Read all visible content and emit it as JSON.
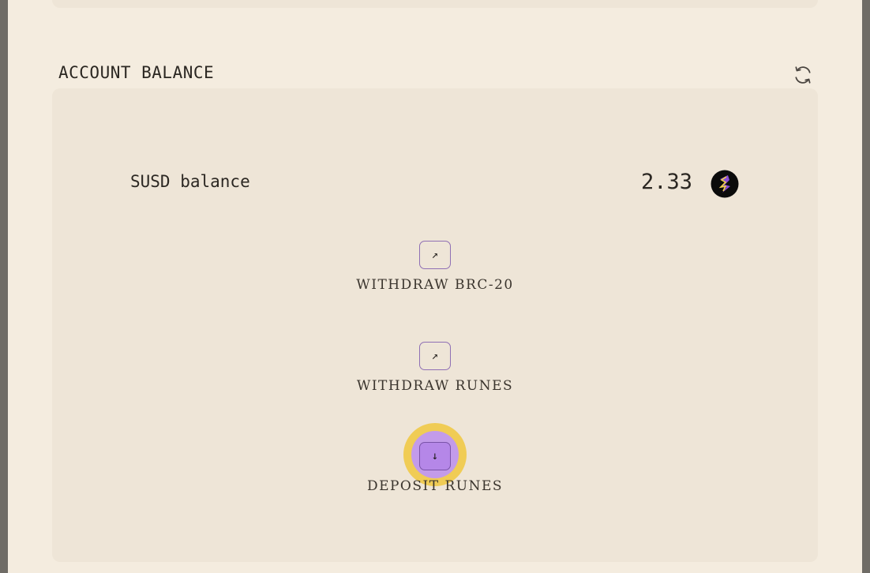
{
  "section": {
    "title": "ACCOUNT BALANCE",
    "refresh_icon": "refresh-icon"
  },
  "balance": {
    "label": "SUSD balance",
    "value": "2.33",
    "token_icon": "susd-token-icon"
  },
  "actions": [
    {
      "label": "WITHDRAW BRC-20",
      "icon": "arrow-up-right-icon",
      "glyph": "↗"
    },
    {
      "label": "WITHDRAW RUNES",
      "icon": "arrow-up-right-icon",
      "glyph": "↗"
    },
    {
      "label": "DEPOSIT RUNES",
      "icon": "arrow-down-icon",
      "glyph": "↓"
    }
  ],
  "colors": {
    "background": "#f4ecdf",
    "card": "#eee5d7",
    "accent_purple": "#8f6fb4",
    "highlight_yellow": "#f0cc55",
    "highlight_purple": "#c39bea"
  }
}
